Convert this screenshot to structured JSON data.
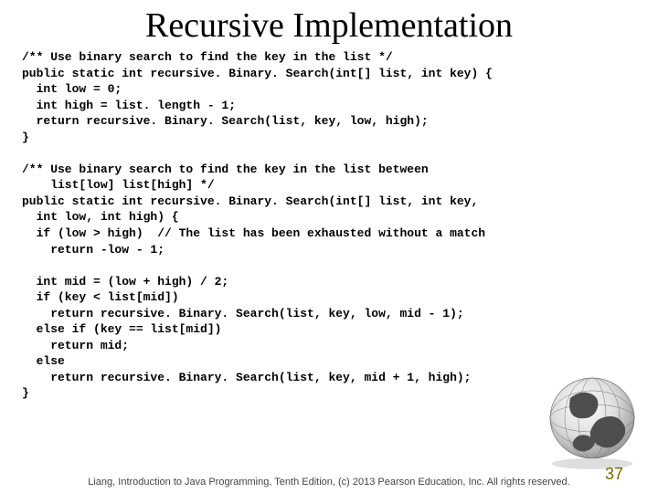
{
  "title": "Recursive Implementation",
  "code": "/** Use binary search to find the key in the list */\npublic static int recursive. Binary. Search(int[] list, int key) {\n  int low = 0;\n  int high = list. length - 1;\n  return recursive. Binary. Search(list, key, low, high);\n}\n\n/** Use binary search to find the key in the list between\n    list[low] list[high] */\npublic static int recursive. Binary. Search(int[] list, int key,\n  int low, int high) {\n  if (low > high)  // The list has been exhausted without a match\n    return -low - 1;\n\n  int mid = (low + high) / 2;\n  if (key < list[mid])\n    return recursive. Binary. Search(list, key, low, mid - 1);\n  else if (key == list[mid])\n    return mid;\n  else\n    return recursive. Binary. Search(list, key, mid + 1, high);\n}",
  "footer": "Liang, Introduction to Java Programming, Tenth Edition, (c) 2013 Pearson Education, Inc. All\nrights reserved.",
  "page": "37"
}
